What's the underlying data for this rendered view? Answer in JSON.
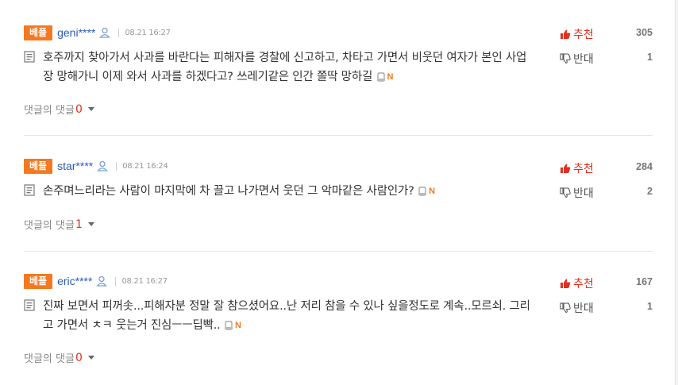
{
  "comments": [
    {
      "badge": "베플",
      "user": "geni****",
      "time": "08.21 16:27",
      "text": "호주까지 찾아가서 사과를 바란다는 피해자를 경찰에 신고하고, 차타고 가면서 비웃던 여자가 본인 사업장 망해가니 이제 와서 사과를 하겠다고? 쓰레기같은 인간 쫄딱 망하길",
      "reply_label": "댓글의 댓글",
      "reply_count": "0",
      "up_label": "추천",
      "up_count": "305",
      "down_label": "반대",
      "down_count": "1"
    },
    {
      "badge": "베플",
      "user": "star****",
      "time": "08.21 16:24",
      "text": "손주며느리라는 사람이 마지막에 차 끌고 나가면서 웃던 그 악마같은 사람인가?",
      "reply_label": "댓글의 댓글",
      "reply_count": "1",
      "up_label": "추천",
      "up_count": "284",
      "down_label": "반대",
      "down_count": "2"
    },
    {
      "badge": "베플",
      "user": "eric****",
      "time": "08.21 16:27",
      "text": "진짜 보면서 피꺼솟...피해자분 정말 잘 참으셨어요..난 저리 참을 수 있나 싶을정도로 계속..모르쇠. 그리고 가면서 ㅊㅋ 웃는거 진심ㅡㅡ딥빡..",
      "reply_label": "댓글의 댓글",
      "reply_count": "0",
      "up_label": "추천",
      "up_count": "167",
      "down_label": "반대",
      "down_count": "1"
    }
  ],
  "icons": {
    "user": "user-icon",
    "doc": "document-icon",
    "thumb_up": "thumbs-up-icon",
    "thumb_down": "thumbs-down-icon",
    "mobile": "mobile-icon",
    "new": "N"
  },
  "colors": {
    "badge": "#f47920",
    "username": "#2b5bb5",
    "up": "#e0301e",
    "reply_count": "#e0301e"
  }
}
